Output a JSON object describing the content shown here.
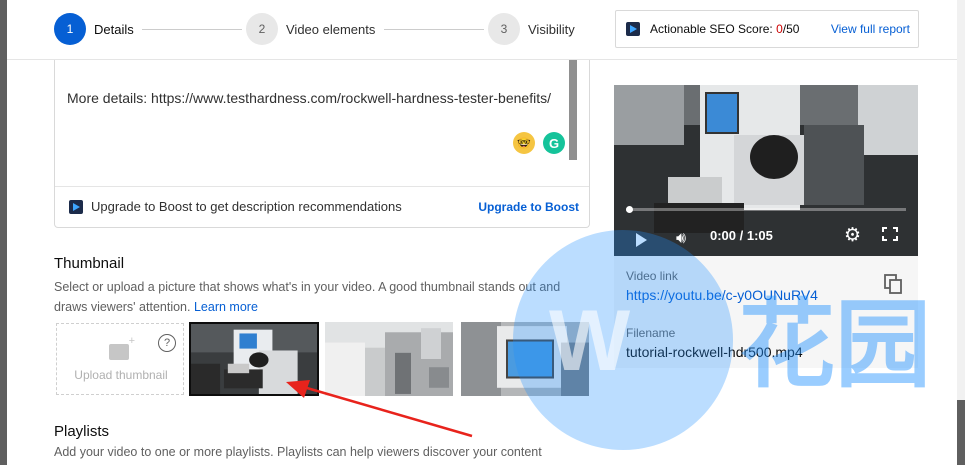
{
  "stepper": {
    "steps": [
      {
        "number": "1",
        "label": "Details"
      },
      {
        "number": "2",
        "label": "Video elements"
      },
      {
        "number": "3",
        "label": "Visibility"
      }
    ]
  },
  "seo": {
    "label": "Actionable SEO Score:",
    "score": "0",
    "max": "/50",
    "link": "View full report"
  },
  "description": {
    "text": "More details: https://www.testhardness.com/rockwell-hardness-tester-benefits/",
    "boost_text": "Upgrade to Boost to get description recommendations",
    "boost_link": "Upgrade to Boost"
  },
  "thumbnail": {
    "title": "Thumbnail",
    "description": "Select or upload a picture that shows what's in your video. A good thumbnail stands out and draws viewers' attention.",
    "learn_more": "Learn more",
    "upload_label": "Upload thumbnail",
    "help_icon": "?"
  },
  "playlists": {
    "title": "Playlists",
    "description": "Add your video to one or more playlists. Playlists can help viewers discover your content"
  },
  "video": {
    "time": "0:00 / 1:05",
    "progress": 0,
    "link_label": "Video link",
    "link": "https://youtu.be/c-y0OUNuRV4",
    "filename_label": "Filename",
    "filename": "tutorial-rockwell-hdr500.mp4"
  },
  "watermark": {
    "letters": "W",
    "chars": "花园"
  },
  "colors": {
    "accent": "#065fd4",
    "score_red": "#cc0000",
    "arrow_red": "#e8231c"
  }
}
